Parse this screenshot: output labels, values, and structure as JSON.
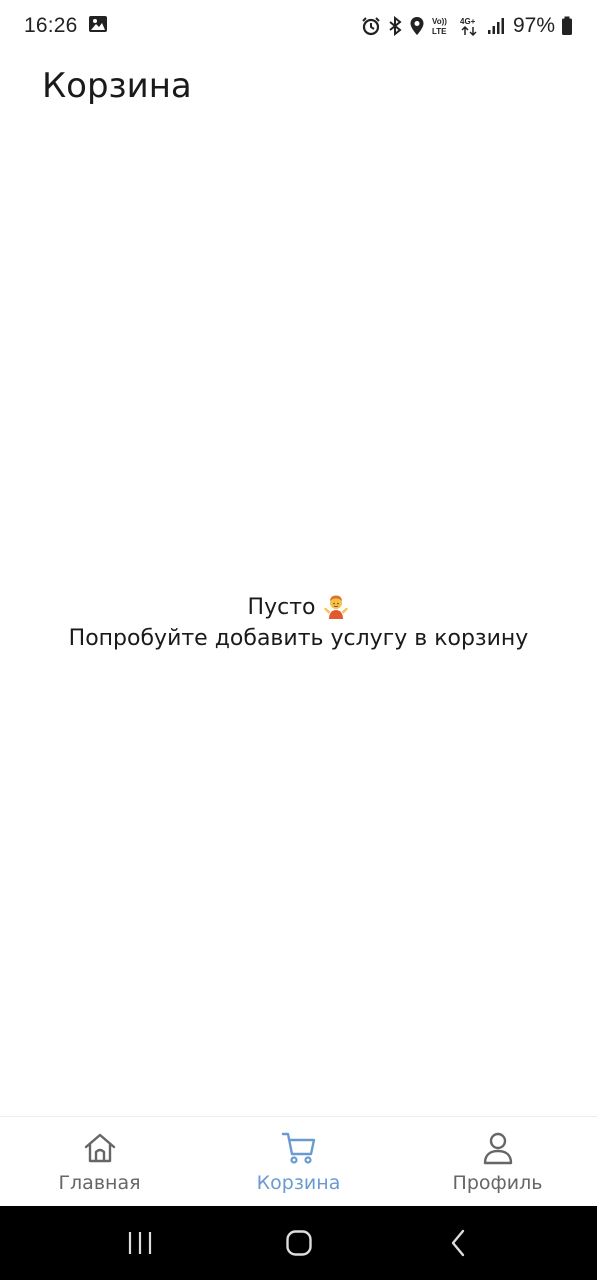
{
  "status_bar": {
    "time": "16:26",
    "battery_percent": "97%",
    "icons": [
      "gallery-icon",
      "alarm-icon",
      "bluetooth-icon",
      "location-icon",
      "volte-icon",
      "4g-icon",
      "signal-icon",
      "battery-icon"
    ]
  },
  "header": {
    "title": "Корзина"
  },
  "empty_state": {
    "line1": "Пусто",
    "line1_icon": "person-shrugging-icon",
    "line2": "Попробуйте добавить услугу в корзину"
  },
  "bottom_nav": {
    "items": [
      {
        "label": "Главная",
        "icon": "home-icon",
        "active": false
      },
      {
        "label": "Корзина",
        "icon": "cart-icon",
        "active": true
      },
      {
        "label": "Профиль",
        "icon": "profile-icon",
        "active": false
      }
    ],
    "active_color": "#6a9bd0",
    "inactive_color": "#666666"
  },
  "system_nav": {
    "buttons": [
      "recent-apps-icon",
      "home-circle-icon",
      "back-icon"
    ]
  }
}
